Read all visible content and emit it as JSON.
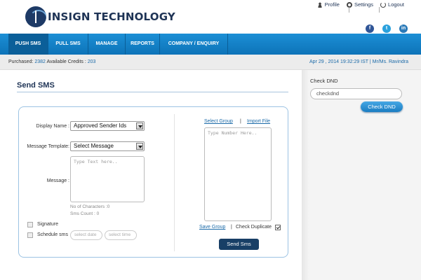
{
  "brand": {
    "name": "INSIGN TECHNOLOGY"
  },
  "toplinks": {
    "profile": "Profile",
    "settings": "Settings",
    "logout": "Logout"
  },
  "social": {
    "facebook": "f",
    "twitter": "t",
    "linkedin": "in"
  },
  "nav": {
    "items": [
      {
        "label": "PUSH SMS",
        "active": true
      },
      {
        "label": "PULL SMS"
      },
      {
        "label": "MANAGE"
      },
      {
        "label": "REPORTS"
      },
      {
        "label": "COMPANY / ENQUIRY"
      }
    ]
  },
  "infobar": {
    "purchased_label": "Purchased:",
    "purchased_value": "2382",
    "credits_label": "Available Credits :",
    "credits_value": "203",
    "datetime_user": "Apr 29 , 2014 19:32:29 IST | Mr/Ms. Ravindra"
  },
  "form": {
    "title": "Send SMS",
    "display_name_label": "Display Name :",
    "display_name_value": "Approved Sender Ids",
    "template_label": "Message Template:",
    "template_value": "Select Message",
    "message_label": "Message :",
    "message_placeholder": "Type Text here..",
    "char_count": "No of Characters :0",
    "sms_count": "Sms Count : 0",
    "signature_label": "Signature",
    "schedule_label": "Schedule sms",
    "date_placeholder": "select date",
    "time_placeholder": "select time",
    "select_group": "Select Group",
    "divider": "|",
    "import_file": "Import File",
    "numbers_placeholder": "Type Number Here..",
    "save_group": "Save Group",
    "check_duplicate": "Check Duplicate",
    "send_button": "Send Sms"
  },
  "sidebar": {
    "title": "Check DND",
    "input_value": "checkdnd",
    "button": "Check DND"
  },
  "colors": {
    "nav": "#1580c7",
    "navy": "#183f66",
    "link": "#1b6aa8"
  }
}
